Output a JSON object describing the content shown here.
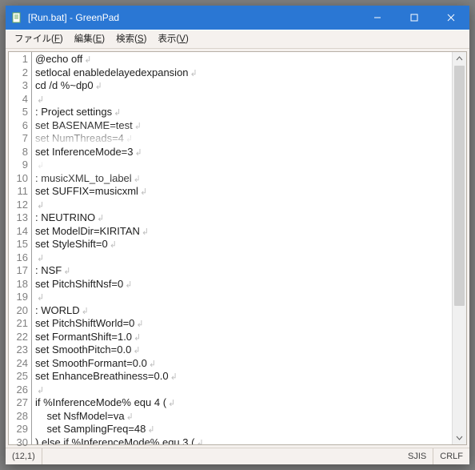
{
  "window": {
    "title": "[Run.bat] - GreenPad"
  },
  "menu": {
    "items": [
      {
        "label_pre": "ファイル(",
        "accel": "F",
        "label_post": ")"
      },
      {
        "label_pre": "編集(",
        "accel": "E",
        "label_post": ")"
      },
      {
        "label_pre": "検索(",
        "accel": "S",
        "label_post": ")"
      },
      {
        "label_pre": "表示(",
        "accel": "V",
        "label_post": ")"
      }
    ]
  },
  "editor": {
    "highlight_line_index": 7,
    "lines": [
      "@echo off",
      "setlocal enabledelayedexpansion",
      "cd /d %~dp0",
      "",
      ": Project settings",
      "set BASENAME=test",
      "set NumThreads=4",
      "set InferenceMode=3",
      "",
      ": musicXML_to_label",
      "set SUFFIX=musicxml",
      "",
      ": NEUTRINO",
      "set ModelDir=KIRITAN",
      "set StyleShift=0",
      "",
      ": NSF",
      "set PitchShiftNsf=0",
      "",
      ": WORLD",
      "set PitchShiftWorld=0",
      "set FormantShift=1.0",
      "set SmoothPitch=0.0",
      "set SmoothFormant=0.0",
      "set EnhanceBreathiness=0.0",
      "",
      "if %InferenceMode% equ 4 (",
      "    set NsfModel=va",
      "    set SamplingFreq=48",
      ") else if %InferenceMode% equ 3 ("
    ]
  },
  "status": {
    "cursor": "(12,1)",
    "encoding": "SJIS",
    "lineending": "CRLF"
  }
}
